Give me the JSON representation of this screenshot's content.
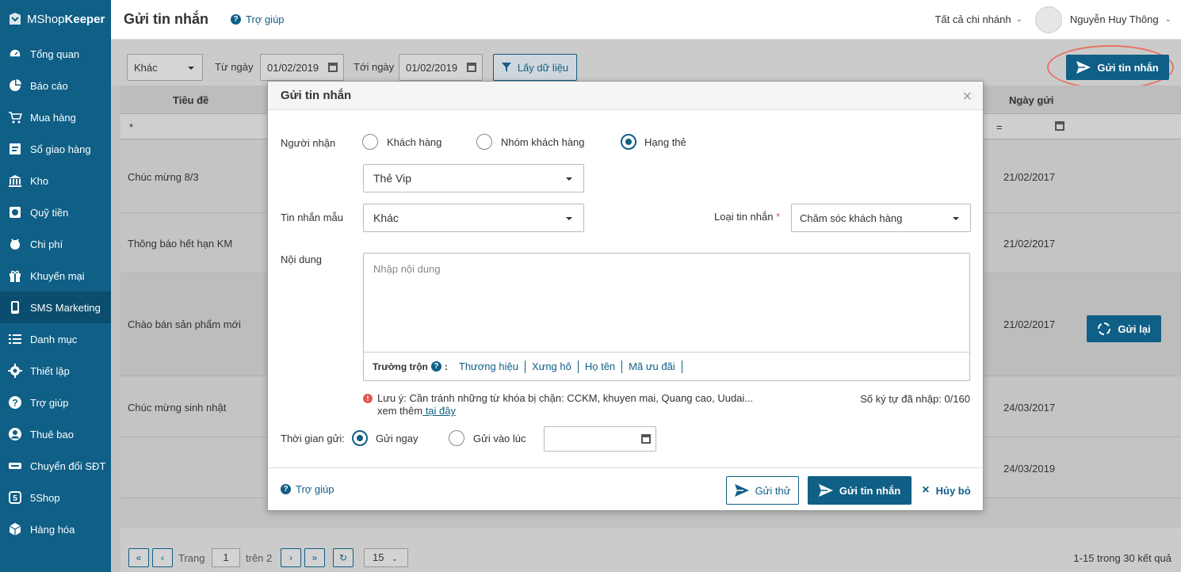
{
  "app": {
    "brand_light": "MShop",
    "brand_bold": "Keeper"
  },
  "sidebar": {
    "items": [
      {
        "label": "Tổng quan",
        "icon": "dashboard-icon"
      },
      {
        "label": "Báo cáo",
        "icon": "pie-chart-icon"
      },
      {
        "label": "Mua hàng",
        "icon": "cart-icon"
      },
      {
        "label": "Sổ giao hàng",
        "icon": "delivery-book-icon"
      },
      {
        "label": "Kho",
        "icon": "warehouse-icon"
      },
      {
        "label": "Quỹ tiền",
        "icon": "cash-icon"
      },
      {
        "label": "Chi phí",
        "icon": "expense-icon"
      },
      {
        "label": "Khuyến mại",
        "icon": "gift-icon"
      },
      {
        "label": "SMS Marketing",
        "icon": "phone-icon"
      },
      {
        "label": "Danh mục",
        "icon": "list-icon"
      },
      {
        "label": "Thiết lập",
        "icon": "gear-icon"
      },
      {
        "label": "Trợ giúp",
        "icon": "help-icon"
      },
      {
        "label": "Thuê bao",
        "icon": "user-icon"
      },
      {
        "label": "Chuyển đổi SĐT",
        "icon": "convert-icon"
      },
      {
        "label": "5Shop",
        "icon": "5shop-icon"
      },
      {
        "label": "Hàng hóa",
        "icon": "goods-icon"
      }
    ]
  },
  "header": {
    "title": "Gửi tin nhắn",
    "help": "Trợ giúp",
    "branch": "Tất cả chi nhánh",
    "user": "Nguyễn Huy Thông"
  },
  "filter": {
    "type": "Khác",
    "from_label": "Từ ngày",
    "from": "01/02/2019",
    "to_label": "Tới ngày",
    "to": "01/02/2019",
    "get_btn": "Lấy dữ liệu",
    "send_btn": "Gửi tin nhắn"
  },
  "table": {
    "col_title": "Tiêu đề",
    "col_date": "Ngày gửi",
    "filter_star": "*",
    "filter_eq": "=",
    "rows": [
      {
        "title": "Chúc mừng 8/3",
        "date": "21/02/2017"
      },
      {
        "title": "Thông báo hết hạn KM",
        "date": "21/02/2017"
      },
      {
        "title": "Chào bán sản phẩm mới",
        "date": "21/02/2017"
      },
      {
        "title": "Chúc mừng sinh nhật",
        "date": "24/03/2017"
      },
      {
        "title": "",
        "date": "24/03/2019"
      }
    ],
    "resend": "Gửi lại"
  },
  "pager": {
    "page_label": "Trang",
    "page": "1",
    "of": "trên 2",
    "size": "15",
    "summary": "1-15 trong 30 kết quả"
  },
  "modal": {
    "title": "Gửi tin nhắn",
    "recipient_label": "Người nhận",
    "opt_customer": "Khách hàng",
    "opt_group": "Nhóm khách hàng",
    "opt_tier": "Hạng thẻ",
    "tier_value": "Thẻ Vip",
    "template_label": "Tin nhắn mẫu",
    "template_value": "Khác",
    "type_label": "Loại tin nhắn",
    "type_required": "*",
    "type_value": "Chăm sóc khách hàng",
    "content_label": "Nội dung",
    "content_placeholder": "Nhập nội dung",
    "merge_label": "Trường trộn",
    "merge_fields": [
      "Thương hiệu",
      "Xưng hô",
      "Họ tên",
      "Mã ưu đãi"
    ],
    "note_line1": "Lưu ý: Cần tránh những từ khóa bị chặn: CCKM, khuyen mai, Quang cao, Uudai...",
    "note_line2": "xem thêm",
    "note_link": " tại đây",
    "counter": "Số ký tự đã nhập: 0/160",
    "time_label": "Thời gian gửi:",
    "opt_now": "Gửi ngay",
    "opt_at": "Gửi vào lúc",
    "help": "Trợ giúp",
    "test_btn": "Gửi thử",
    "send_btn": "Gửi tin nhắn",
    "cancel_btn": "Hủy bỏ"
  }
}
